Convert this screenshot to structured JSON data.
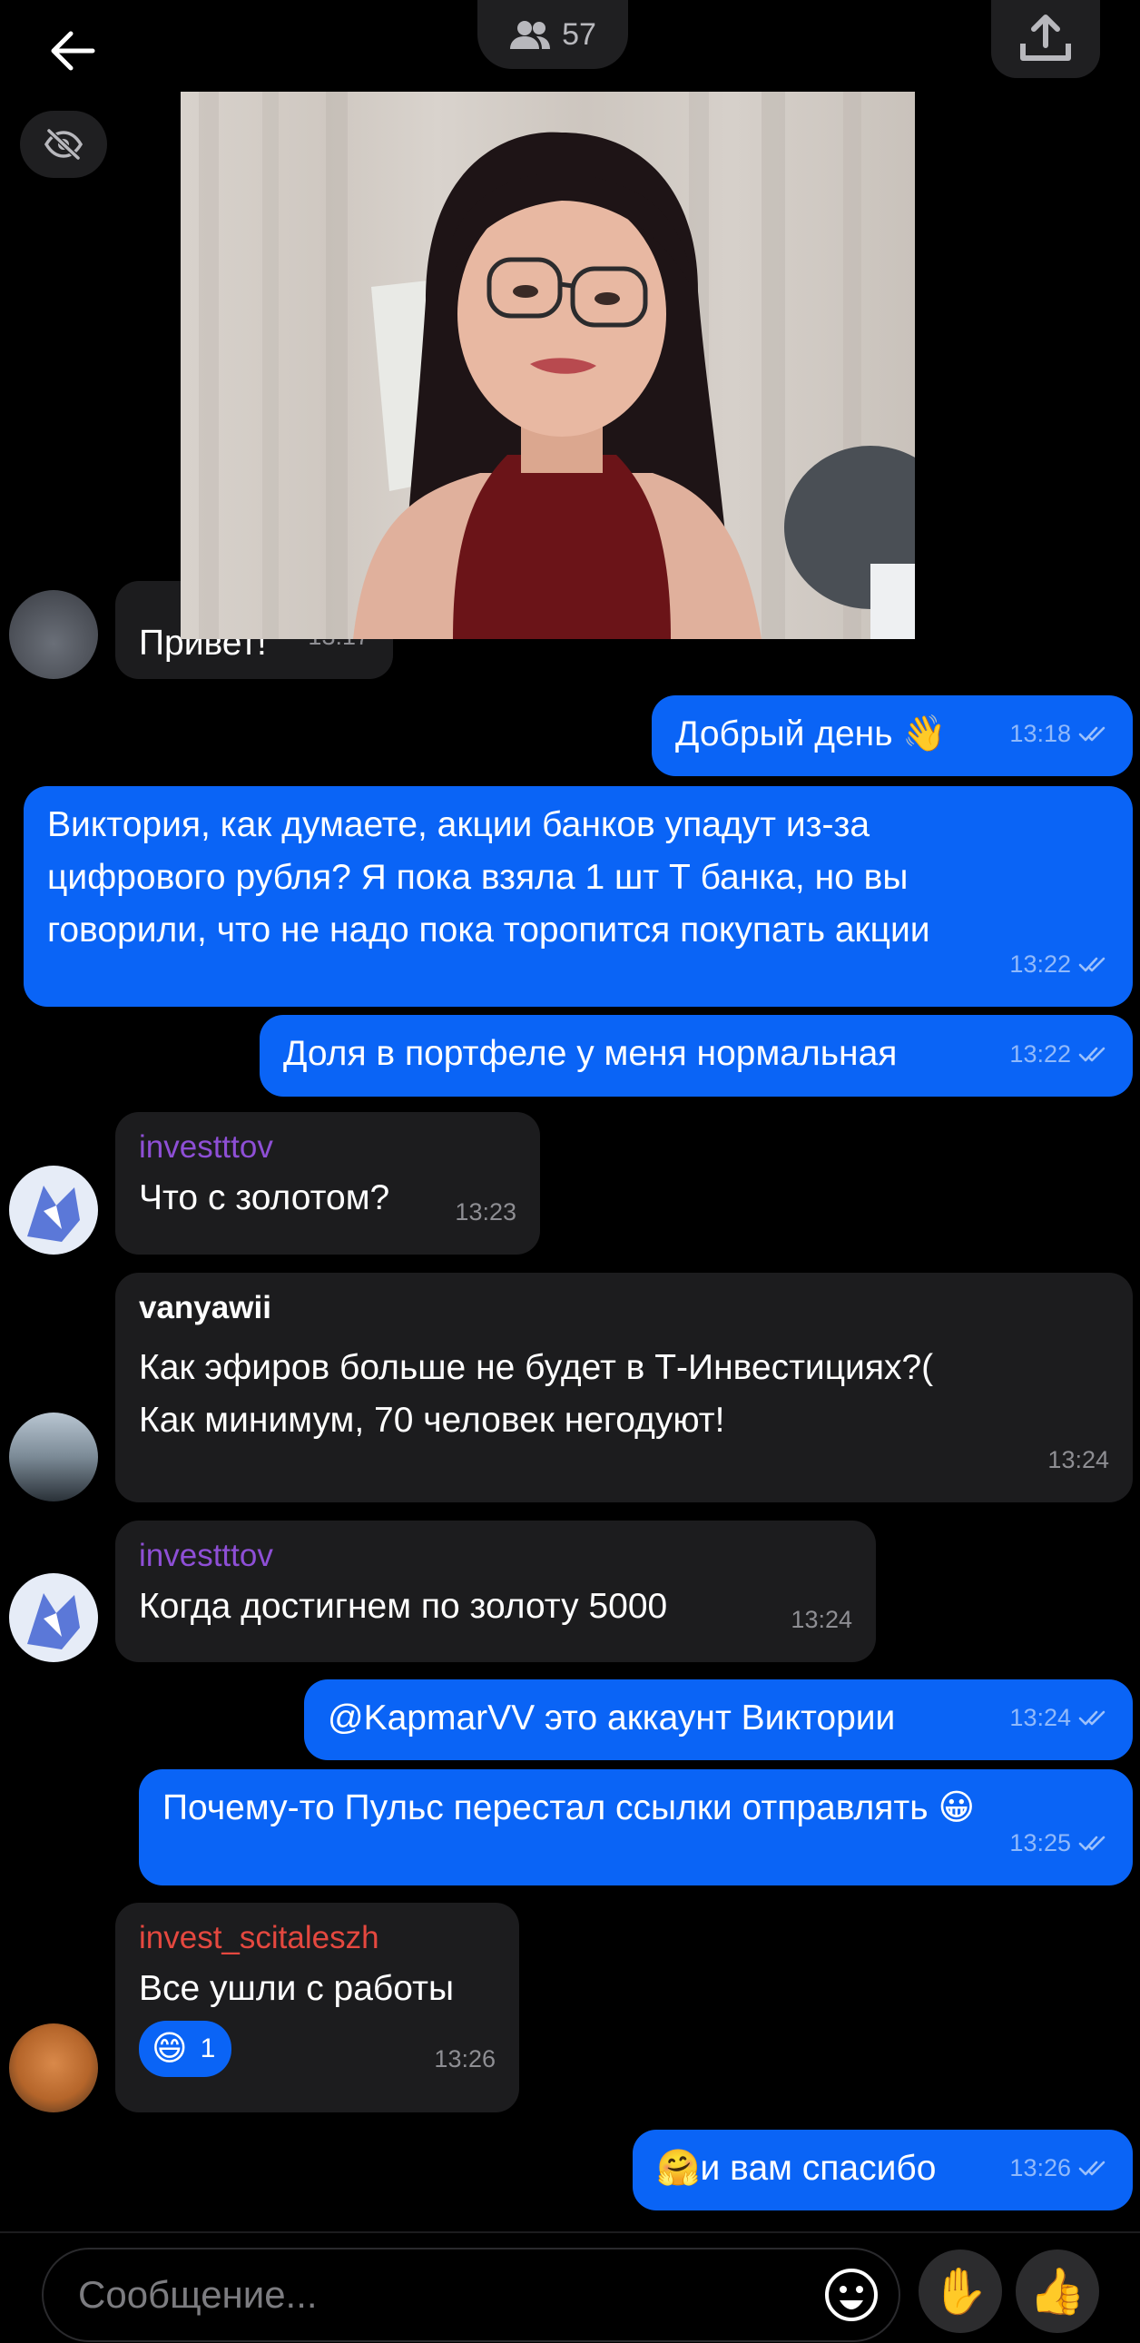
{
  "header": {
    "back_icon": "arrow-left-icon",
    "viewers_icon": "people-icon",
    "viewers_count": "57",
    "share_icon": "upload-icon",
    "hide_icon": "eye-off-icon"
  },
  "video": {
    "description_icon": "live-video"
  },
  "messages": [
    {
      "id": "m1",
      "direction": "in",
      "text": "Привет!",
      "time": "13:17"
    },
    {
      "id": "m2",
      "direction": "out",
      "text": "Добрый день 👋",
      "time": "13:18"
    },
    {
      "id": "m3",
      "direction": "out",
      "lines": [
        "Виктория, как думаете, акции банков упадут из-за",
        "цифрового рубля? Я пока взяла 1 шт Т банка, но вы",
        "говорили, что не надо пока торопится покупать акции"
      ],
      "time": "13:22"
    },
    {
      "id": "m4",
      "direction": "out",
      "text": "Доля в портфеле у меня нормальная",
      "time": "13:22"
    },
    {
      "id": "m5",
      "direction": "in",
      "author": "investttov",
      "author_color": "#8e4fd6",
      "text": "Что с золотом?",
      "time": "13:23"
    },
    {
      "id": "m6",
      "direction": "in",
      "author": "vanyawii",
      "author_color": "#ffffff",
      "lines": [
        "Как эфиров больше не будет в Т-Инвестициях?(",
        "Как минимум, 70 человек негодуют!"
      ],
      "time": "13:24"
    },
    {
      "id": "m7",
      "direction": "in",
      "author": "investttov",
      "author_color": "#8e4fd6",
      "text": "Когда достигнем по золоту 5000",
      "time": "13:24"
    },
    {
      "id": "m8",
      "direction": "out",
      "text": "@KapmarVV это аккаунт Виктории",
      "time": "13:24"
    },
    {
      "id": "m9",
      "direction": "out",
      "text": "Почему-то Пульс перестал ссылки отправлять 😀",
      "time": "13:25"
    },
    {
      "id": "m10",
      "direction": "in",
      "author": "invest_scitaleszh",
      "author_color": "#e5483f",
      "text": "Все ушли с работы",
      "time": "13:26",
      "reaction": {
        "emoji": "😄",
        "count": "1"
      }
    },
    {
      "id": "m11",
      "direction": "out",
      "text": "🤗и вам спасибо",
      "time": "13:26"
    }
  ],
  "composer": {
    "placeholder": "Сообщение...",
    "emoji_icon": "smiley-icon",
    "hand_button": "✋",
    "like_button": "👍"
  },
  "colors": {
    "background": "#000000",
    "incoming_bubble": "#1c1c1e",
    "outgoing_bubble": "#0a64f6"
  }
}
